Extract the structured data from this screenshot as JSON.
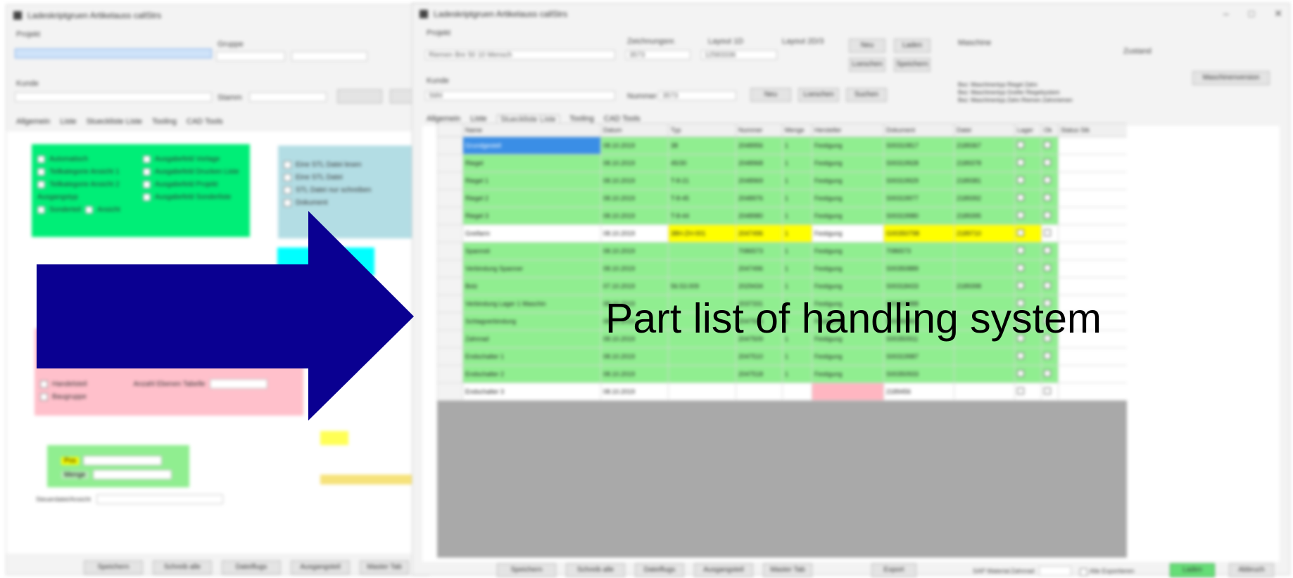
{
  "caption": "Part list of handling system",
  "colors": {
    "arrow": "#0a0091",
    "row_green": "#90ee90",
    "highlight_yellow": "#ffff00",
    "highlight_pink": "#ffb6c1",
    "selection_blue": "#3a8ee6",
    "grid_background": "#a9a9a9"
  },
  "back_window": {
    "title": "Ladeskriptgruen Artikelauss callStrs",
    "field_label_1": "Projekt",
    "field_label_2": "Gruppe",
    "field_label_3": "Kunde",
    "field_label_4": "Stamm",
    "tabs": [
      "Allgemein",
      "Liste",
      "Stueckliste Liste",
      "Tooling",
      "CAD Tools"
    ],
    "bottom_buttons": [
      "Speichern",
      "Schreib alle",
      "Dateiflugs",
      "Ausgangsteil",
      "Master Tab"
    ],
    "panel_green_items": [
      "Automatisch",
      "Teilkategorie Ansicht 1",
      "Teilkategorie Ansicht 2",
      "Ausgangstyp",
      "Sonderteil",
      "Ansicht"
    ],
    "panel_green_items_right": [
      "Ausgabefeld Vorlage",
      "Ausgabefeld Drucken Liste",
      "Ausgabefeld Projekt",
      "Ausgabefeld Sonderliste"
    ],
    "panel_blue_items": [
      "Eine STL Datei lesen",
      "Eine STL Datei",
      "STL Datei nur schreiben",
      "Dokument"
    ],
    "panel_pink_items": [
      "Handelsteil",
      "Baugruppe"
    ],
    "panel_pink_field": "Anzahl Ebenen Tabelle",
    "panel_small_green": [
      "Pos",
      "Menge"
    ],
    "footer_label": "Steuerdatei/Ansicht"
  },
  "front_window": {
    "title": "Ladeskriptgruen Artikelauss callStrs",
    "window_controls": [
      "–",
      "□",
      "✕"
    ],
    "labels": {
      "project": "Projekt",
      "drawing_number": "Zeichnungsnr.",
      "layout_1": "Layout 1D",
      "layout_2": "Layout 2D/3",
      "customer": "Kunde",
      "number": "Nummer",
      "machine": "Maschine",
      "status": "Zustand"
    },
    "inputs": {
      "project": "Riemen Bre 50 10 Mensch",
      "drawing_number": "3573",
      "layout_1": "12583336",
      "customer": "Stihl",
      "number": "3573"
    },
    "buttons_top": [
      "Neu",
      "Laden",
      "Loeschen",
      "Speichern"
    ],
    "buttons_mid": [
      "Neu",
      "Loeschen",
      "Suchen"
    ],
    "right_panel_lines": [
      "Bez: Maschinentyp Riegel Zahn",
      "Bez: Maschinentyp Greifer Riegelsystem",
      "Bez: Maschinentyp Zahn Riemen Zahnriemen"
    ],
    "right_button": "Maschinenversion",
    "tabs": [
      "Allgemein",
      "Liste",
      "Stueckliste Liste",
      "Tooling",
      "CAD Tools"
    ],
    "table_headers": [
      "",
      "Name",
      "Datum",
      "Typ",
      "Nummer",
      "Menge",
      "Hersteller",
      "Dokument",
      "Datei",
      "Lager",
      "Ok",
      "Status Stk"
    ],
    "rows": [
      {
        "name": "Grundgestell",
        "date": "08.10.2019",
        "type": "38",
        "num": "2048956",
        "qty": "1",
        "maker": "Festigung",
        "doc": "S00310817",
        "file": "2189367",
        "style": "green",
        "name_style": "blue"
      },
      {
        "name": "Riegel",
        "date": "08.10.2019",
        "type": "45/30",
        "num": "2048968",
        "qty": "1",
        "maker": "Festigung",
        "doc": "S00319928",
        "file": "2189378",
        "style": "green"
      },
      {
        "name": "Riegel 1",
        "date": "08.10.2019",
        "type": "T-8-21",
        "num": "2048969",
        "qty": "1",
        "maker": "Festigung",
        "doc": "S00319929",
        "file": "2189381",
        "style": "green"
      },
      {
        "name": "Riegel 2",
        "date": "08.10.2019",
        "type": "T-8-45",
        "num": "2048976",
        "qty": "1",
        "maker": "Festigung",
        "doc": "S00319977",
        "file": "2189392",
        "style": "green"
      },
      {
        "name": "Riegel 3",
        "date": "08.10.2019",
        "type": "T-8-44",
        "num": "2048980",
        "qty": "1",
        "maker": "Festigung",
        "doc": "S00319980",
        "file": "2189395",
        "style": "green"
      },
      {
        "name": "Greifarm",
        "date": "08.10.2019",
        "type": "38H-ZH-001",
        "num": "2047496",
        "qty": "1",
        "maker": "Festigung",
        "doc": "G00350798",
        "file": "2189710",
        "style": "white",
        "yellow": true
      },
      {
        "name": "Spannsti",
        "date": "08.10.2019",
        "type": "",
        "num": "7086573",
        "qty": "1",
        "maker": "Festigung",
        "doc": "7086573",
        "file": "",
        "style": "green"
      },
      {
        "name": "Verbindung Spanner",
        "date": "08.10.2019",
        "type": "",
        "num": "2047496",
        "qty": "1",
        "maker": "Festigung",
        "doc": "S00350889",
        "file": "",
        "style": "green"
      },
      {
        "name": "Bolz",
        "date": "07.10.2019",
        "type": "56.53.009",
        "num": "2029434",
        "qty": "1",
        "maker": "Festigung",
        "doc": "S00318433",
        "file": "2189398",
        "style": "green"
      },
      {
        "name": "Verbindung Lager 1 Maschin",
        "date": "08.10.2019",
        "type": "",
        "num": "2037331",
        "qty": "1",
        "maker": "Festigung",
        "doc": "S00319988",
        "file": "",
        "style": "green"
      },
      {
        "name": "Schlagverbindung",
        "date": "08.10.2019",
        "type": "",
        "num": "2047506",
        "qty": "1",
        "maker": "Festigung",
        "doc": "S00350901",
        "file": "",
        "style": "green"
      },
      {
        "name": "Zahnrad",
        "date": "08.10.2019",
        "type": "",
        "num": "2047509",
        "qty": "1",
        "maker": "Festigung",
        "doc": "S00350911",
        "file": "",
        "style": "green"
      },
      {
        "name": "Endschalter 1",
        "date": "08.10.2019",
        "type": "",
        "num": "2047510",
        "qty": "1",
        "maker": "Festigung",
        "doc": "S00319987",
        "file": "",
        "style": "green"
      },
      {
        "name": "Endschalter 2",
        "date": "08.10.2019",
        "type": "",
        "num": "2047518",
        "qty": "1",
        "maker": "Festigung",
        "doc": "S00350933",
        "file": "",
        "style": "green"
      },
      {
        "name": "Endschalter 3",
        "date": "08.10.2019",
        "type": "",
        "num": "",
        "qty": "",
        "maker": "",
        "doc": "2189456",
        "file": "",
        "style": "white",
        "pink": true
      }
    ],
    "bottom_buttons": [
      "Speichern",
      "Schreib alle",
      "Dateiflugs",
      "Ausgangsteil",
      "Master Tab"
    ],
    "bottom_mid_button": "Export",
    "footer_field_label": "SAP Material",
    "footer_field_value": "Zahnrad",
    "footer_check_label": "Alle Exportieren",
    "footer_btn_ok": "Laden",
    "footer_btn_cancel": "Abbruch"
  }
}
